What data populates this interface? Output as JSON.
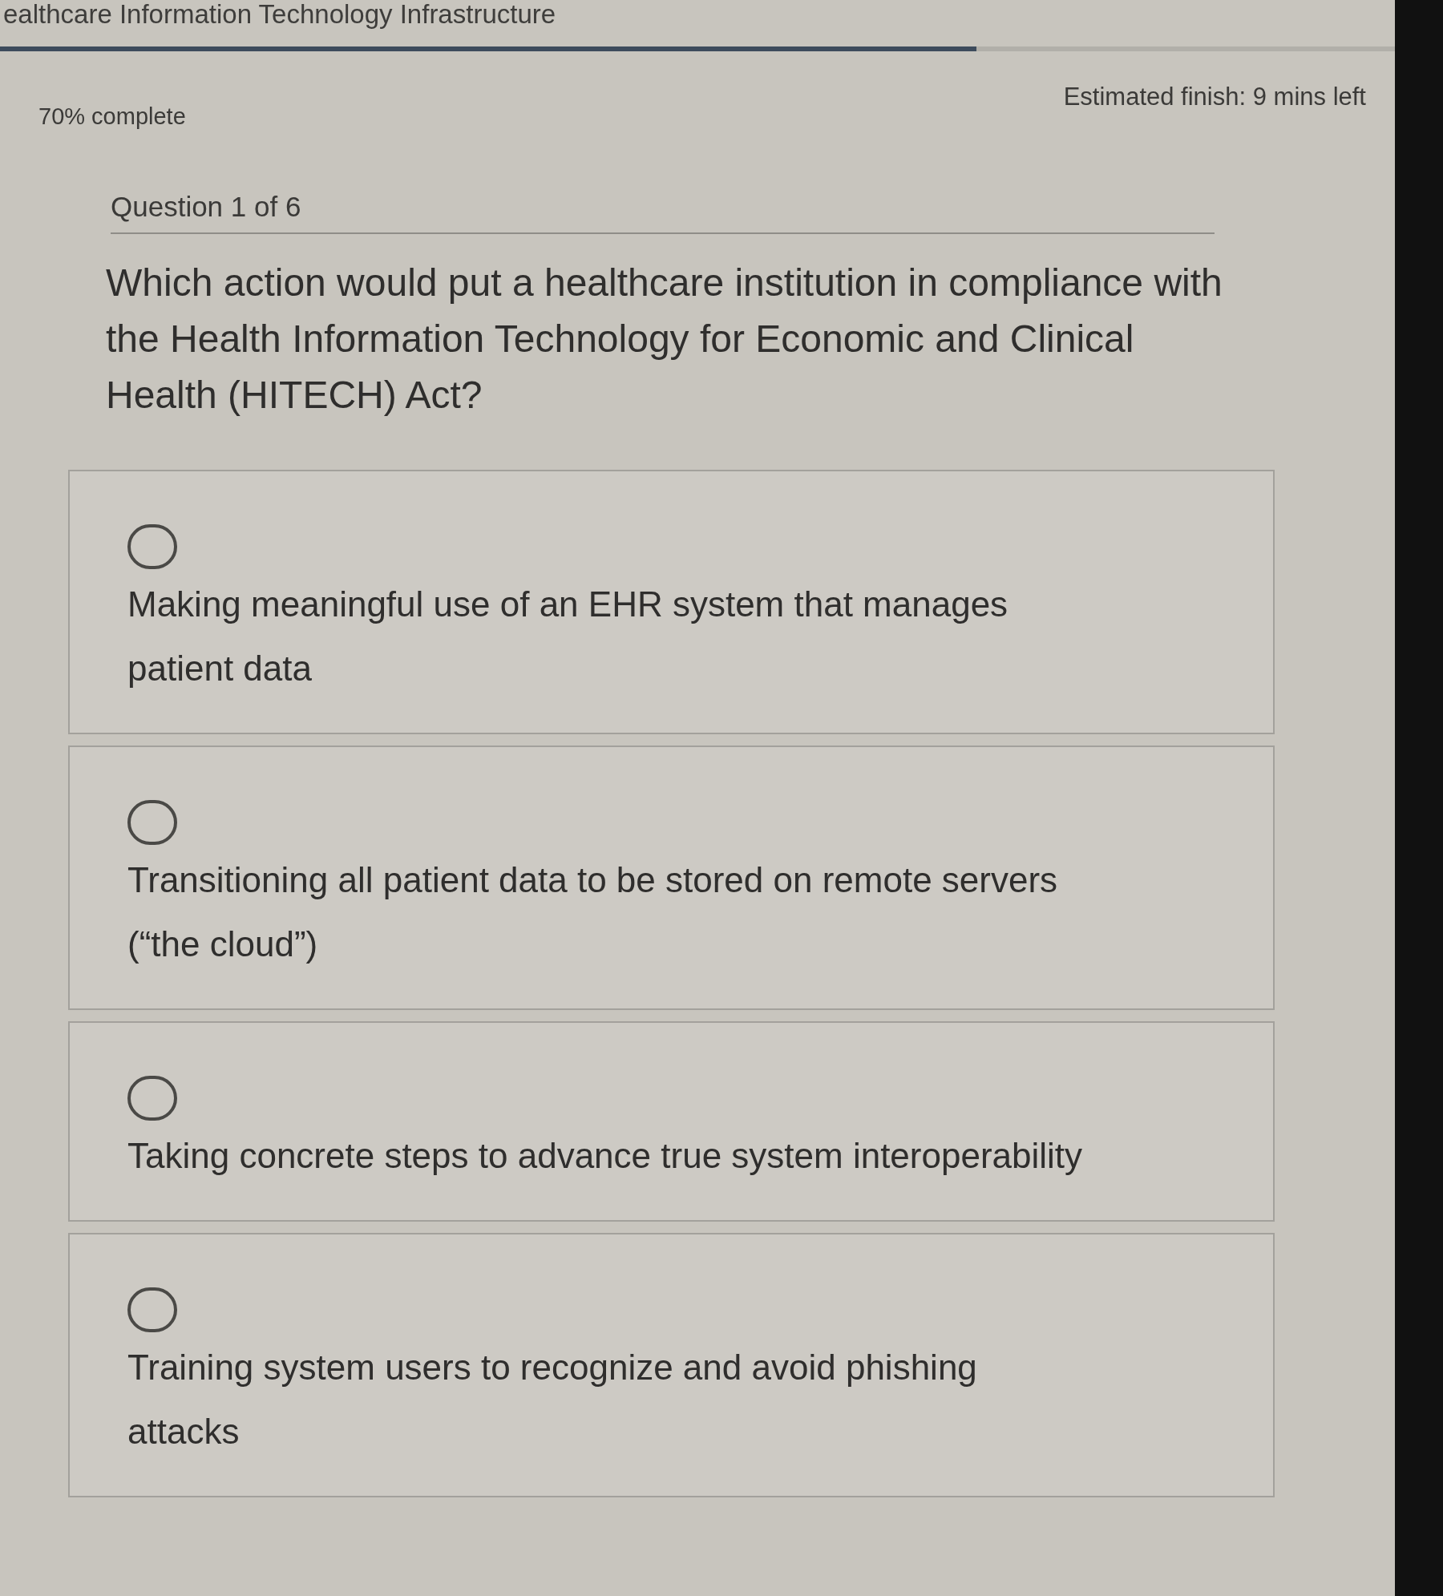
{
  "header": {
    "title": "ealthcare Information Technology Infrastructure"
  },
  "progress": {
    "level": 0.7,
    "label": "70% complete",
    "estimate": "Estimated finish: 9 mins left"
  },
  "question": {
    "counter": "Question 1 of 6",
    "text": "Which action would put a healthcare institution in compliance with the Health Information Technology for Economic and Clinical Health (HITECH) Act?"
  },
  "options": [
    {
      "label": "Making meaningful use of an EHR system that manages patient data",
      "selected": false
    },
    {
      "label": "Transitioning all patient data to be stored on remote servers (“the cloud”)",
      "selected": false
    },
    {
      "label": "Taking concrete steps to advance true system interoperability",
      "selected": false
    },
    {
      "label": "Training system users to recognize and avoid phishing attacks",
      "selected": false
    }
  ]
}
